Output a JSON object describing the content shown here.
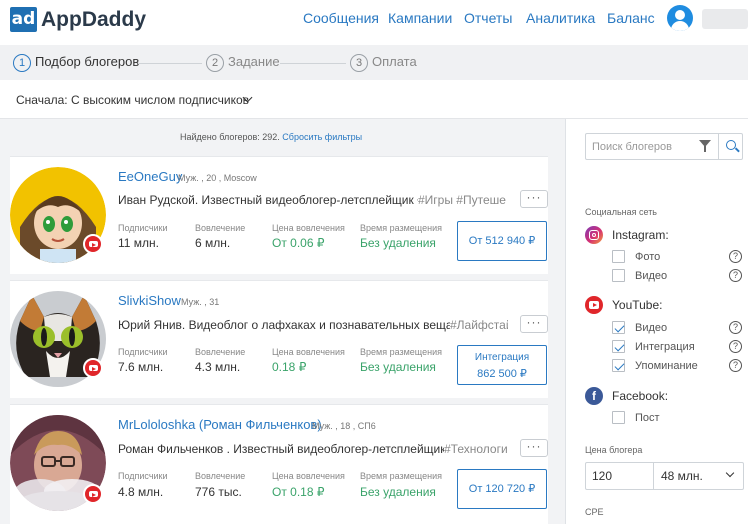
{
  "header": {
    "logo_mark": "ad",
    "logo_text": "AppDaddy",
    "nav": [
      "Сообщения",
      "Кампании",
      "Отчеты",
      "Аналитика",
      "Баланс"
    ]
  },
  "steps": [
    {
      "num": "1",
      "label": "Подбор блогеров"
    },
    {
      "num": "2",
      "label": "Задание"
    },
    {
      "num": "3",
      "label": "Оплата"
    }
  ],
  "sort": {
    "label": "Сначала: С высоким числом подписчиков"
  },
  "results": {
    "found_text": "Найдено блогеров: 292.",
    "reset_link": "Сбросить фильтры"
  },
  "stat_labels": {
    "subscribers": "Подписчики",
    "engagement": "Вовлечение",
    "cpe": "Цена вовлечения",
    "placement": "Время размещения"
  },
  "more_label": "···",
  "bloggers": [
    {
      "name": "EeOneGuy",
      "meta": "Муж. , 20 , Moscow",
      "description": "Иван Рудской. Известный видеоблогер-летсплейщик  •",
      "tags": "#Игры  #Путешествия",
      "subscribers": "11 млн.",
      "engagement": "6 млн.",
      "cpe": "От 0.06 ₽",
      "placement": "Без удаления",
      "price": "От 512 940 ₽"
    },
    {
      "name": "SlivkiShow",
      "meta": "Муж. , 31",
      "description": "Юрий Янив. Видеоблог о лафхаках и познавательных вещах  •",
      "tags": "#Лайфстайл",
      "subscribers": "7.6 млн.",
      "engagement": "4.3 млн.",
      "cpe": "0.18 ₽",
      "placement": "Без удаления",
      "price_top": "Интеграция",
      "price_bottom": "862 500 ₽"
    },
    {
      "name": "MrLololoshka (Роман Фильченков)",
      "meta": "Муж. , 18 , СП6",
      "description": "Роман Фильченков . Известный видеоблогер-летсплейщик  •",
      "tags": "#Технологии",
      "subscribers": "4.8 млн.",
      "engagement": "776 тыс.",
      "cpe": "От 0.18 ₽",
      "placement": "Без удаления",
      "price": "От 120 720 ₽"
    }
  ],
  "filters": {
    "search_placeholder": "Поиск блогеров",
    "social_title": "Социальная сеть",
    "instagram": {
      "label": "Instagram:",
      "options": [
        {
          "label": "Фото",
          "checked": false
        },
        {
          "label": "Видео",
          "checked": false
        }
      ]
    },
    "youtube": {
      "label": "YouTube:",
      "options": [
        {
          "label": "Видео",
          "checked": true
        },
        {
          "label": "Интеграция",
          "checked": true
        },
        {
          "label": "Упоминание",
          "checked": true
        }
      ]
    },
    "facebook": {
      "label": "Facebook:",
      "options": [
        {
          "label": "Пост",
          "checked": false
        }
      ]
    },
    "price_title": "Цена блогера",
    "price_from": "120",
    "price_to": "48 млн.",
    "cpe_title": "CPE",
    "help_glyph": "?"
  },
  "colors": {
    "accent": "#2a79c2",
    "logo": "#1f6fb2",
    "green": "#3aa36a",
    "youtube": "#e0262a",
    "facebook": "#3b5998"
  }
}
